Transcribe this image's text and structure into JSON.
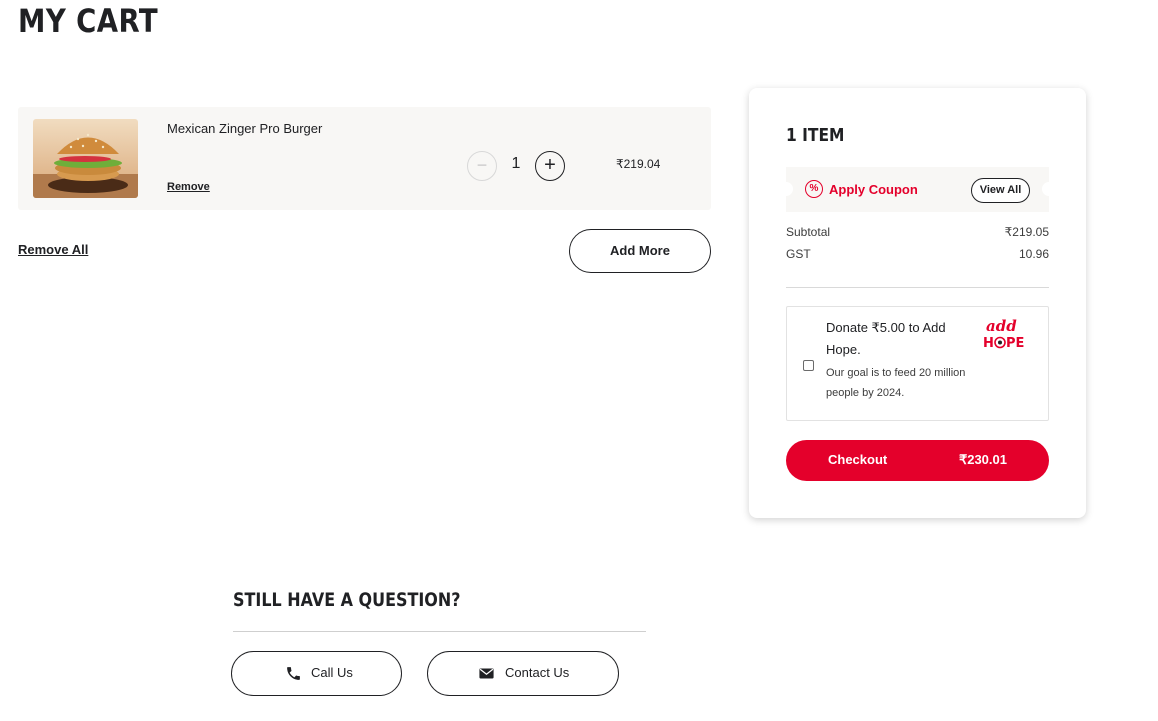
{
  "page": {
    "title": "MY CART"
  },
  "cart": {
    "items": [
      {
        "name": "Mexican Zinger Pro Burger",
        "remove_label": "Remove",
        "quantity": "1",
        "minus_icon": "−",
        "plus_icon": "+",
        "price": "₹219.04",
        "image_icon": "burger-image"
      }
    ],
    "remove_all_label": "Remove All",
    "add_more_label": "Add More"
  },
  "summary": {
    "items_count": "1 ITEM",
    "coupon": {
      "icon": "%",
      "label": "Apply Coupon",
      "view_all_label": "View All"
    },
    "subtotal": {
      "label": "Subtotal",
      "value": "₹219.05"
    },
    "gst": {
      "label": "GST",
      "value": "10.96"
    },
    "donate": {
      "title": "Donate ₹5.00 to Add Hope.",
      "subtitle": "Our goal is to feed 20 million people by 2024.",
      "checked": false,
      "logo": "add-hope-logo"
    },
    "checkout": {
      "label": "Checkout",
      "total": "₹230.01"
    }
  },
  "help": {
    "title": "STILL HAVE A QUESTION?",
    "call_label": "Call Us",
    "contact_label": "Contact Us"
  },
  "colors": {
    "brand_red": "#e4002b",
    "text_dark": "#202124",
    "panel_bg": "#f8f7f5"
  }
}
